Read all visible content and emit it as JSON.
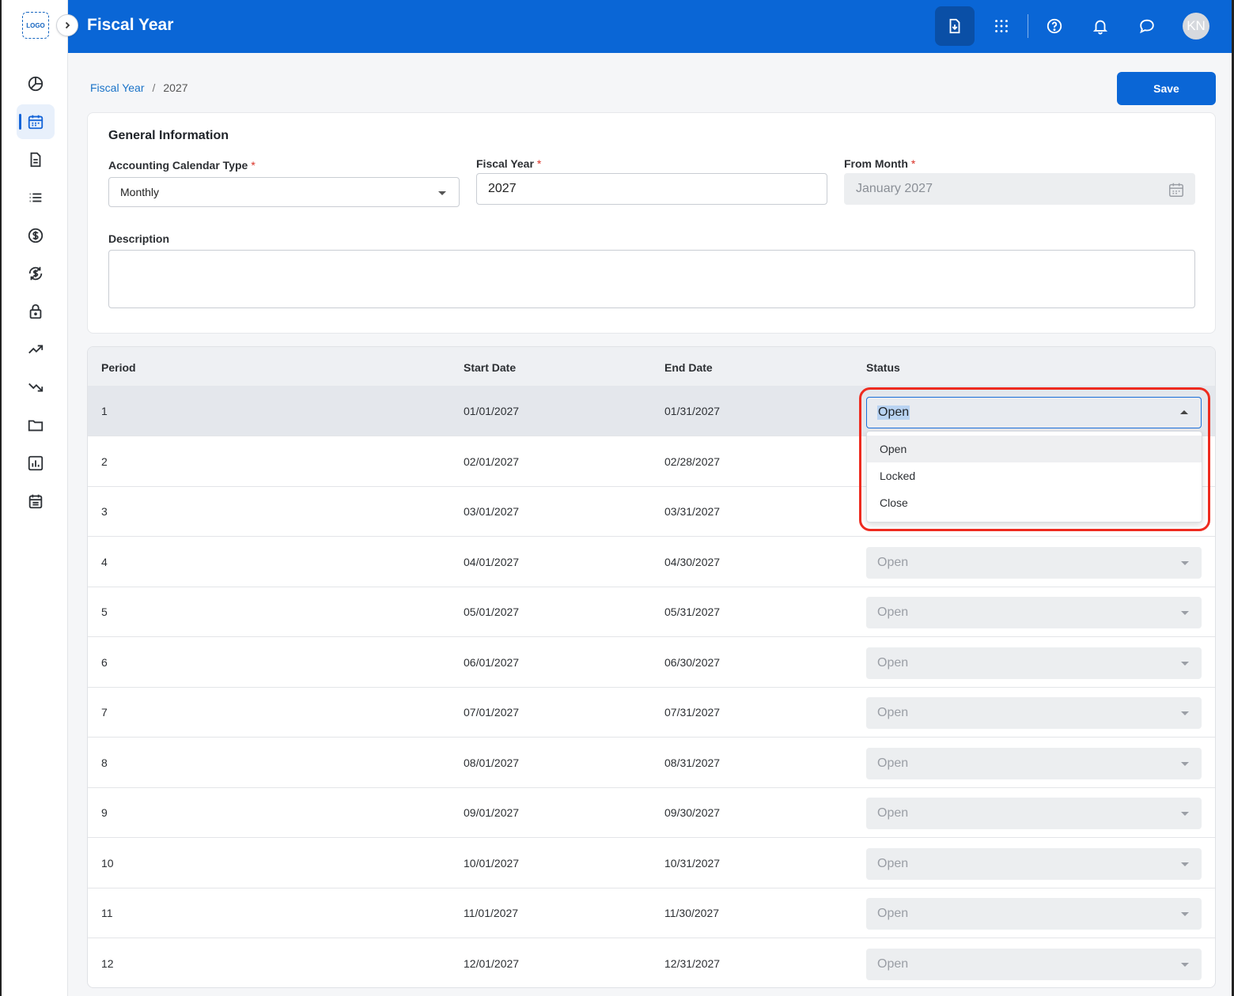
{
  "app": {
    "title": "Fiscal Year",
    "logo_text": "LOGO",
    "avatar_initials": "KN"
  },
  "sidebar": {
    "items": [
      {
        "name": "dashboard",
        "icon": "pie-chart-icon"
      },
      {
        "name": "fiscal-calendar",
        "icon": "calendar-icon",
        "active": true
      },
      {
        "name": "documents",
        "icon": "document-icon"
      },
      {
        "name": "list",
        "icon": "list-icon"
      },
      {
        "name": "payments",
        "icon": "dollar-icon"
      },
      {
        "name": "currency-exchange",
        "icon": "dollar-refresh-icon"
      },
      {
        "name": "security",
        "icon": "lock-icon"
      },
      {
        "name": "income",
        "icon": "trending-up-icon"
      },
      {
        "name": "expenses",
        "icon": "trending-down-icon"
      },
      {
        "name": "files",
        "icon": "folder-icon"
      },
      {
        "name": "reports",
        "icon": "bar-chart-icon"
      },
      {
        "name": "schedule",
        "icon": "calendar-list-icon"
      }
    ]
  },
  "header": {
    "icons": [
      "download-document-icon",
      "apps-grid-icon",
      "help-icon",
      "bell-icon",
      "chat-icon"
    ]
  },
  "breadcrumb": {
    "root": "Fiscal Year",
    "separator": "/",
    "current": "2027"
  },
  "actions": {
    "save_label": "Save"
  },
  "general": {
    "title": "General Information",
    "calendar_type": {
      "label": "Accounting Calendar Type",
      "value": "Monthly"
    },
    "fiscal_year": {
      "label": "Fiscal Year",
      "value": "2027"
    },
    "from_month": {
      "label": "From Month",
      "value": "January 2027"
    },
    "description": {
      "label": "Description",
      "value": ""
    },
    "required_mark": "*"
  },
  "table": {
    "headers": {
      "period": "Period",
      "start": "Start Date",
      "end": "End Date",
      "status": "Status"
    },
    "rows": [
      {
        "period": "1",
        "start": "01/01/2027",
        "end": "01/31/2027",
        "status": "Open"
      },
      {
        "period": "2",
        "start": "02/01/2027",
        "end": "02/28/2027",
        "status": "Open"
      },
      {
        "period": "3",
        "start": "03/01/2027",
        "end": "03/31/2027",
        "status": "Open"
      },
      {
        "period": "4",
        "start": "04/01/2027",
        "end": "04/30/2027",
        "status": "Open"
      },
      {
        "period": "5",
        "start": "05/01/2027",
        "end": "05/31/2027",
        "status": "Open"
      },
      {
        "period": "6",
        "start": "06/01/2027",
        "end": "06/30/2027",
        "status": "Open"
      },
      {
        "period": "7",
        "start": "07/01/2027",
        "end": "07/31/2027",
        "status": "Open"
      },
      {
        "period": "8",
        "start": "08/01/2027",
        "end": "08/31/2027",
        "status": "Open"
      },
      {
        "period": "9",
        "start": "09/01/2027",
        "end": "09/30/2027",
        "status": "Open"
      },
      {
        "period": "10",
        "start": "10/01/2027",
        "end": "10/31/2027",
        "status": "Open"
      },
      {
        "period": "11",
        "start": "11/01/2027",
        "end": "11/30/2027",
        "status": "Open"
      },
      {
        "period": "12",
        "start": "12/01/2027",
        "end": "12/31/2027",
        "status": "Open"
      }
    ]
  },
  "status_dropdown": {
    "options": [
      "Open",
      "Locked",
      "Close"
    ],
    "hovered": "Open"
  },
  "colors": {
    "brand": "#0a66d6",
    "required": "#d93025",
    "annotation": "#ee2b1f"
  }
}
